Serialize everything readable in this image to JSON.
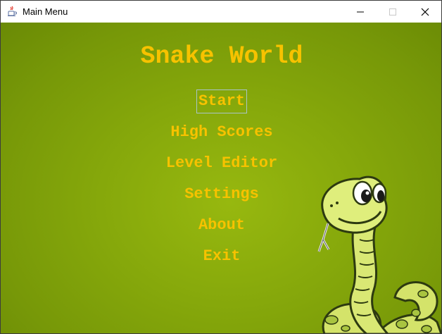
{
  "window": {
    "title": "Main Menu",
    "icon": "java-cup-icon",
    "controls": [
      "minimize",
      "maximize",
      "close"
    ]
  },
  "game": {
    "title": "Snake World",
    "menu": [
      {
        "id": "start",
        "label": "Start",
        "focused": true
      },
      {
        "id": "high-scores",
        "label": "High Scores",
        "focused": false
      },
      {
        "id": "level-editor",
        "label": "Level Editor",
        "focused": false
      },
      {
        "id": "settings",
        "label": "Settings",
        "focused": false
      },
      {
        "id": "about",
        "label": "About",
        "focused": false
      },
      {
        "id": "exit",
        "label": "Exit",
        "focused": false
      }
    ],
    "mascot": "cartoon-snake"
  },
  "colors": {
    "text": "#f7c200",
    "background": "#8fb00d",
    "focus_border": "#a9c4c8"
  }
}
